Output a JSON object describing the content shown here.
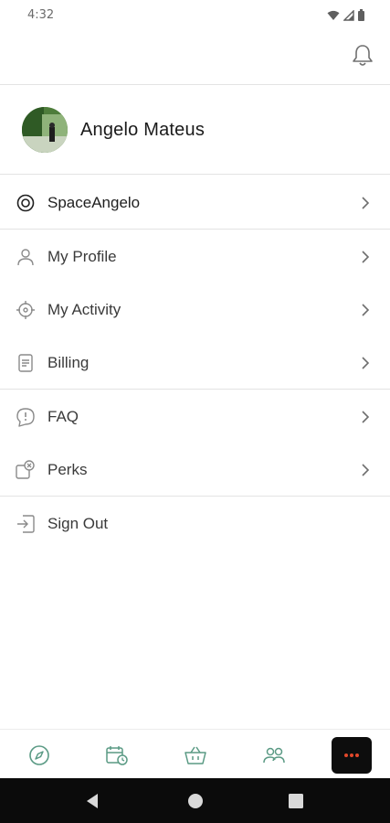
{
  "status_bar": {
    "time": "4:32"
  },
  "profile": {
    "name": "Angelo Mateus"
  },
  "menu": {
    "items": [
      {
        "label": "SpaceAngelo",
        "icon": "target-icon"
      },
      {
        "label": "My Profile",
        "icon": "person-icon"
      },
      {
        "label": "My Activity",
        "icon": "crosshair-icon"
      },
      {
        "label": "Billing",
        "icon": "document-icon"
      },
      {
        "label": "FAQ",
        "icon": "help-bubble-icon"
      },
      {
        "label": "Perks",
        "icon": "perks-icon"
      },
      {
        "label": "Sign Out",
        "icon": "sign-out-icon"
      }
    ]
  },
  "bottom_nav": {
    "items": [
      "compass-icon",
      "calendar-clock-icon",
      "basket-icon",
      "people-icon",
      "more-icon"
    ]
  },
  "colors": {
    "accent": "#5a9a84",
    "more_dots": "#e2482b",
    "chevron": "#6e6e6e"
  }
}
